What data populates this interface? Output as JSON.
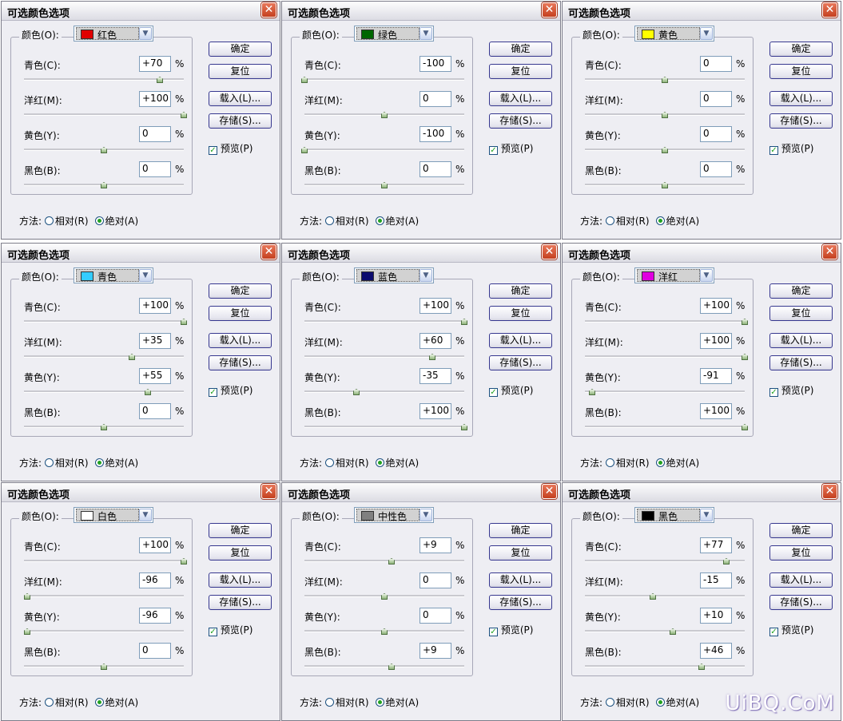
{
  "title": "可选颜色选项",
  "labels": {
    "color": "颜色(O):",
    "cyan": "青色(C):",
    "magenta": "洋红(M):",
    "yellow": "黄色(Y):",
    "black": "黑色(B):",
    "percent": "%",
    "ok": "确定",
    "reset": "复位",
    "load": "载入(L)...",
    "save": "存储(S)...",
    "preview": "预览(P)",
    "method": "方法:",
    "relative": "相对(R)",
    "absolute": "绝对(A)",
    "close": "✕",
    "dropdown": "▼",
    "check": "✓"
  },
  "dialogs": [
    {
      "color_name": "红色",
      "swatch": "#e00000",
      "cyan": "+70",
      "magenta": "+100",
      "yellow": "0",
      "black": "0",
      "method": "absolute"
    },
    {
      "color_name": "绿色",
      "swatch": "#006600",
      "cyan": "-100",
      "magenta": "0",
      "yellow": "-100",
      "black": "0",
      "method": "absolute"
    },
    {
      "color_name": "黄色",
      "swatch": "#ffff00",
      "cyan": "0",
      "magenta": "0",
      "yellow": "0",
      "black": "0",
      "method": "absolute"
    },
    {
      "color_name": "青色",
      "swatch": "#33ccff",
      "cyan": "+100",
      "magenta": "+35",
      "yellow": "+55",
      "black": "0",
      "method": "absolute"
    },
    {
      "color_name": "蓝色",
      "swatch": "#0a0a6e",
      "cyan": "+100",
      "magenta": "+60",
      "yellow": "-35",
      "black": "+100",
      "method": "absolute"
    },
    {
      "color_name": "洋红",
      "swatch": "#e000e0",
      "cyan": "+100",
      "magenta": "+100",
      "yellow": "-91",
      "black": "+100",
      "method": "absolute"
    },
    {
      "color_name": "白色",
      "swatch": "#ffffff",
      "cyan": "+100",
      "magenta": "-96",
      "yellow": "-96",
      "black": "0",
      "method": "absolute"
    },
    {
      "color_name": "中性色",
      "swatch": "#808080",
      "cyan": "+9",
      "magenta": "0",
      "yellow": "0",
      "black": "+9",
      "method": "absolute"
    },
    {
      "color_name": "黑色",
      "swatch": "#000000",
      "cyan": "+77",
      "magenta": "-15",
      "yellow": "+10",
      "black": "+46",
      "method": "absolute"
    }
  ],
  "preview_checked": true,
  "watermark": "UiBQ.CoM"
}
